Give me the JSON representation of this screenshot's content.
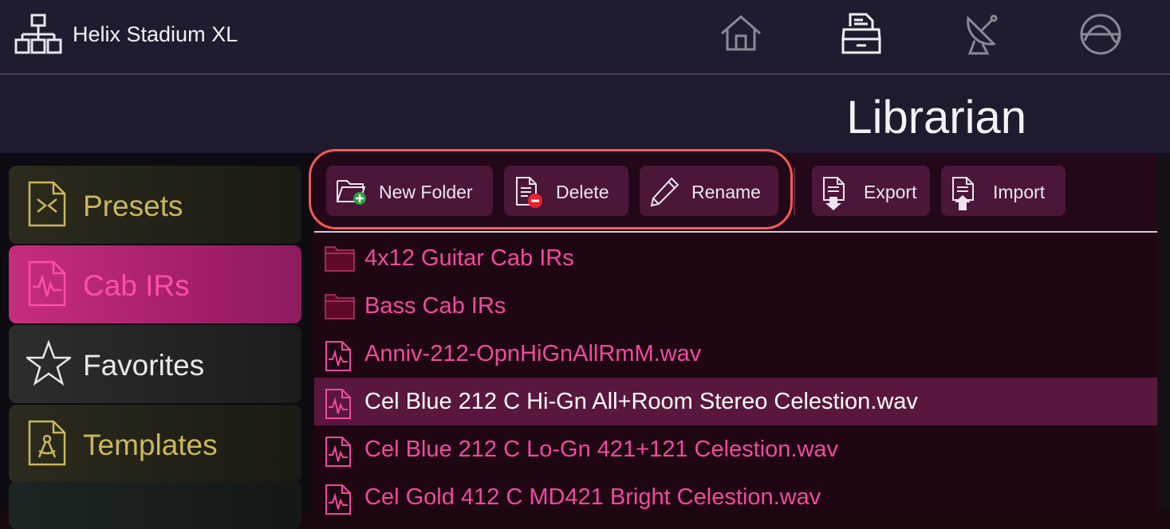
{
  "header": {
    "device_name": "Helix Stadium XL",
    "nav_icons": [
      "home-icon",
      "librarian-icon",
      "satellite-icon",
      "globe-icon"
    ]
  },
  "page": {
    "title": "Librarian"
  },
  "sidebar": {
    "items": [
      {
        "label": "Presets",
        "icon": "preset-file-icon",
        "color": "#cbb65c"
      },
      {
        "label": "Cab IRs",
        "icon": "ir-file-icon",
        "color": "#ff4fa7",
        "selected": true
      },
      {
        "label": "Favorites",
        "icon": "star-icon",
        "color": "#e8e8e8"
      },
      {
        "label": "Templates",
        "icon": "template-file-icon",
        "color": "#cbb65c"
      }
    ]
  },
  "toolbar": {
    "new_folder": "New Folder",
    "delete": "Delete",
    "rename": "Rename",
    "export": "Export",
    "import": "Import"
  },
  "files": [
    {
      "name": "4x12 Guitar Cab IRs",
      "type": "folder"
    },
    {
      "name": "Bass Cab IRs",
      "type": "folder"
    },
    {
      "name": "Anniv-212-OpnHiGnAllRmM.wav",
      "type": "ir"
    },
    {
      "name": "Cel Blue 212 C Hi-Gn All+Room Stereo Celestion.wav",
      "type": "ir",
      "selected": true
    },
    {
      "name": "Cel Blue 212 C Lo-Gn 421+121 Celestion.wav",
      "type": "ir"
    },
    {
      "name": "Cel Gold 412 C MD421 Bright Celestion.wav",
      "type": "ir"
    }
  ],
  "colors": {
    "accent": "#f24a9e",
    "highlight_outline": "#f35b54",
    "button_bg": "#4b1638"
  }
}
